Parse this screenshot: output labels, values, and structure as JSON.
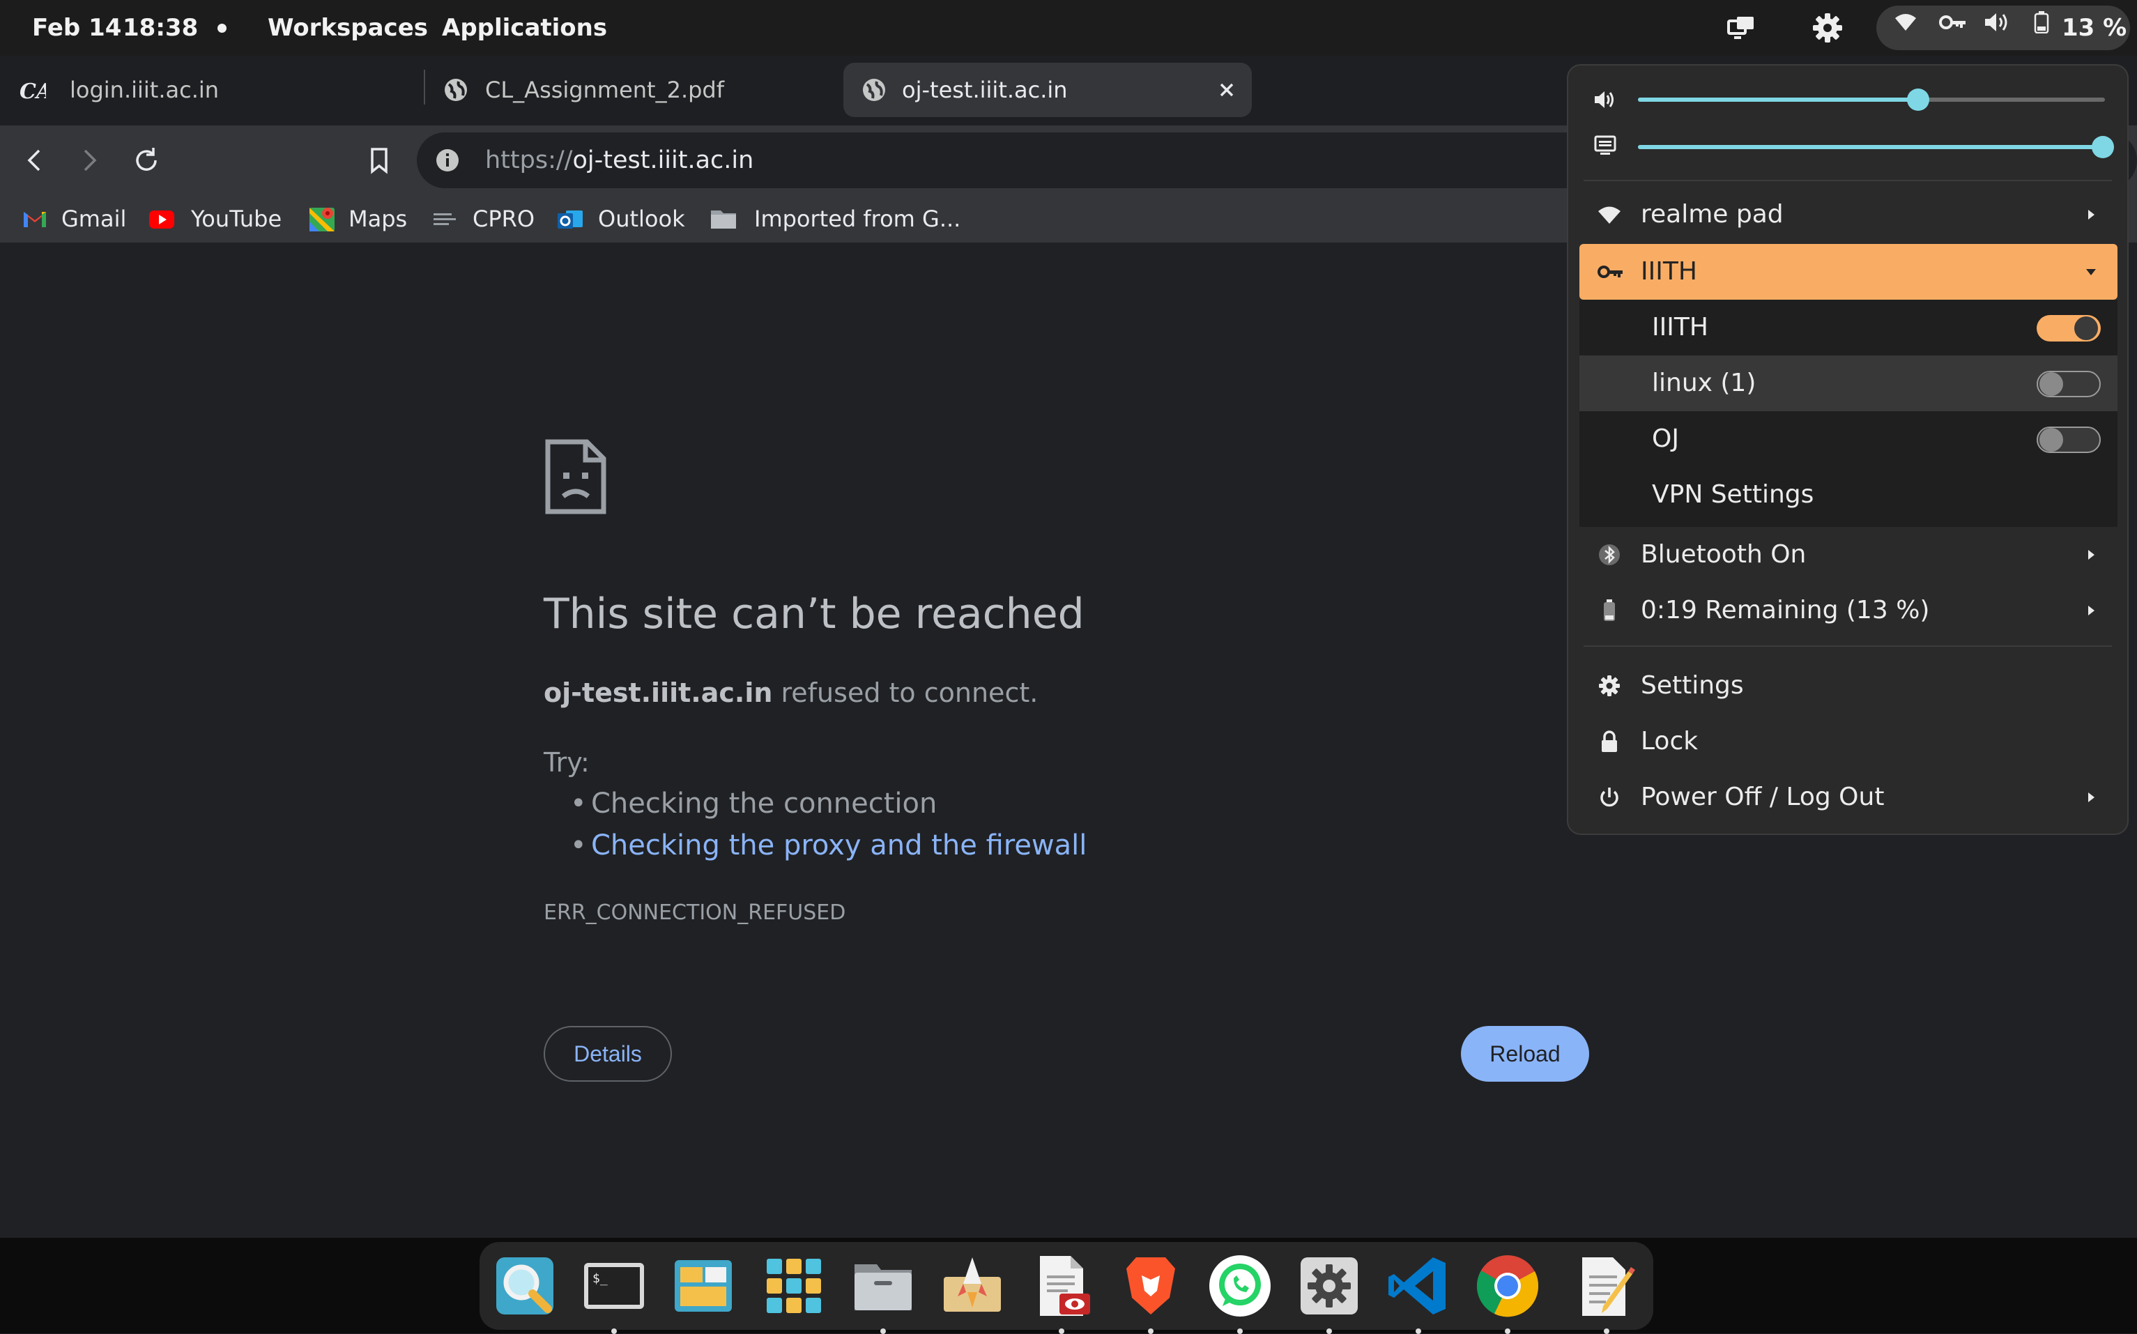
{
  "top_bar": {
    "date": "Feb 14",
    "time": "18:38",
    "workspaces_label": "Workspaces",
    "applications_label": "Applications",
    "battery_percent": "13 %"
  },
  "tabs": [
    {
      "title": "login.iiit.ac.in",
      "icon": "cas-logo-icon"
    },
    {
      "title": "CL_Assignment_2.pdf",
      "icon": "globe-icon"
    },
    {
      "title": "oj-test.iiit.ac.in",
      "icon": "globe-icon",
      "active": true
    }
  ],
  "omnibox": {
    "scheme": "https://",
    "host": "oj-test.iiit.ac.in"
  },
  "bookmarks": [
    {
      "label": "Gmail",
      "icon": "gmail-icon"
    },
    {
      "label": "YouTube",
      "icon": "youtube-icon"
    },
    {
      "label": "Maps",
      "icon": "maps-icon"
    },
    {
      "label": "CPRO",
      "icon": "cpro-icon"
    },
    {
      "label": "Outlook",
      "icon": "outlook-icon"
    },
    {
      "label": "Imported from G...",
      "icon": "folder-icon"
    }
  ],
  "error": {
    "title": "This site can’t be reached",
    "host": "oj-test.iiit.ac.in",
    "message": "refused to connect.",
    "try_label": "Try:",
    "suggestions": [
      "Checking the connection",
      "Checking the proxy and the firewall"
    ],
    "code": "ERR_CONNECTION_REFUSED",
    "details_label": "Details",
    "reload_label": "Reload"
  },
  "quick_settings": {
    "volume_level": 0.6,
    "brightness_level": 1.0,
    "wifi_label": "realme pad",
    "vpn_header": "IIITH",
    "vpn_items": [
      {
        "label": "IIITH",
        "on": true
      },
      {
        "label": "linux (1)",
        "on": false
      },
      {
        "label": "OJ",
        "on": false
      }
    ],
    "vpn_settings_label": "VPN Settings",
    "bluetooth_label": "Bluetooth On",
    "battery_label": "0:19 Remaining (13 %)",
    "settings_label": "Settings",
    "lock_label": "Lock",
    "power_label": "Power Off / Log Out"
  },
  "colors": {
    "accent": "#f9ad64",
    "slider": "#7fd7e5",
    "link": "#8ab4f8"
  },
  "dock_apps": [
    {
      "name": "search-app",
      "running": false
    },
    {
      "name": "terminal-app",
      "running": true
    },
    {
      "name": "window-manager-app",
      "running": false
    },
    {
      "name": "app-grid",
      "running": false
    },
    {
      "name": "files-app",
      "running": true
    },
    {
      "name": "launcher-app",
      "running": false
    },
    {
      "name": "document-viewer-app",
      "running": true
    },
    {
      "name": "brave-browser-app",
      "running": true
    },
    {
      "name": "whatsapp-app",
      "running": true
    },
    {
      "name": "settings-app",
      "running": true
    },
    {
      "name": "vscode-app",
      "running": true
    },
    {
      "name": "chrome-app",
      "running": true
    },
    {
      "name": "text-editor-app",
      "running": true
    }
  ]
}
